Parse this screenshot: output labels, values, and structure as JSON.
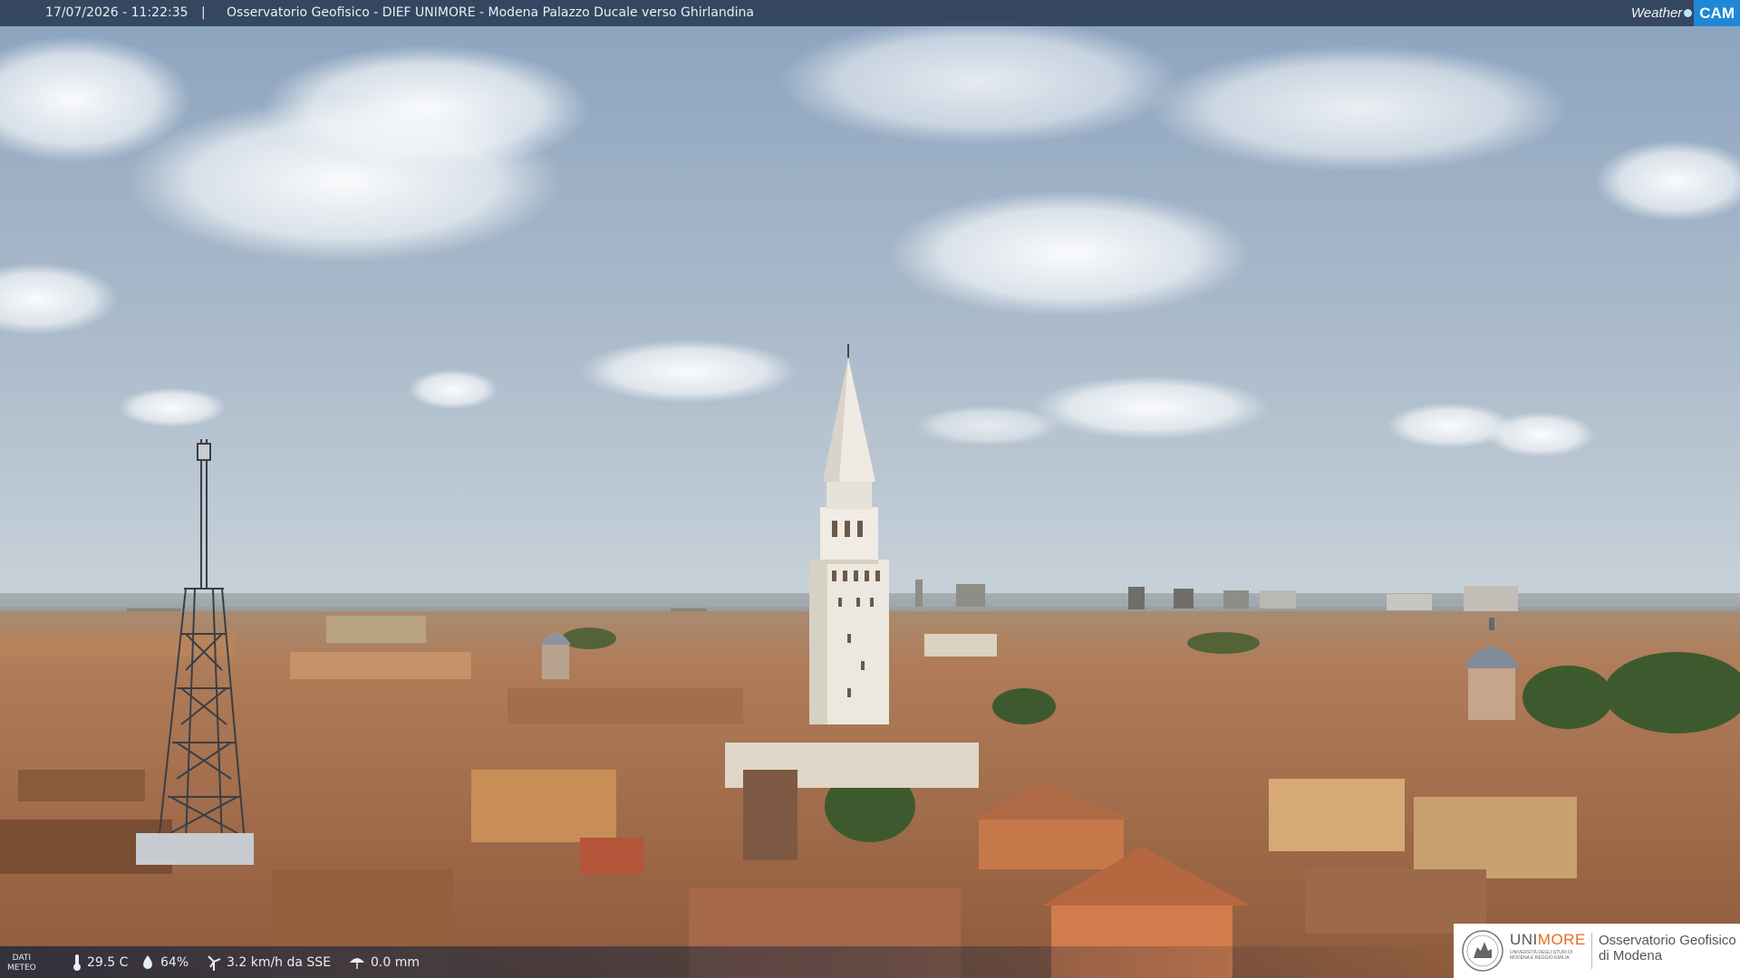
{
  "header": {
    "timestamp": "17/07/2026 - 11:22:35",
    "separator": "|",
    "title": "Osservatorio Geofisico - DIEF UNIMORE - Modena Palazzo Ducale verso Ghirlandina",
    "brand_left": "Weather",
    "brand_right": "CAM"
  },
  "meteo": {
    "label_line1": "DATI",
    "label_line2": "METEO",
    "temperature": "29.5 C",
    "humidity": "64%",
    "wind": "3.2 km/h da SSE",
    "rain": "0.0 mm",
    "icons": [
      "thermometer-icon",
      "humidity-drop-icon",
      "wind-turbine-icon",
      "rain-umbrella-icon"
    ]
  },
  "logo": {
    "uni_prefix": "UNI",
    "uni_suffix": "MORE",
    "uni_subtitle": "UNIVERSITÀ DEGLI STUDI DI MODENA E REGGIO EMILIA",
    "observatory_line1": "Osservatorio Geofisico",
    "observatory_line2": "di Modena",
    "accent": "#e86a1f"
  },
  "scene": {
    "description_tags": [
      "sky",
      "clouds",
      "rooftops",
      "ghirlandina-tower",
      "antenna-tower",
      "dome"
    ],
    "colors": {
      "sky_top": "#8fa6c0",
      "sky_horizon": "#c9d4dc",
      "roof": "#b47a55",
      "tower": "#e6e2da"
    }
  }
}
